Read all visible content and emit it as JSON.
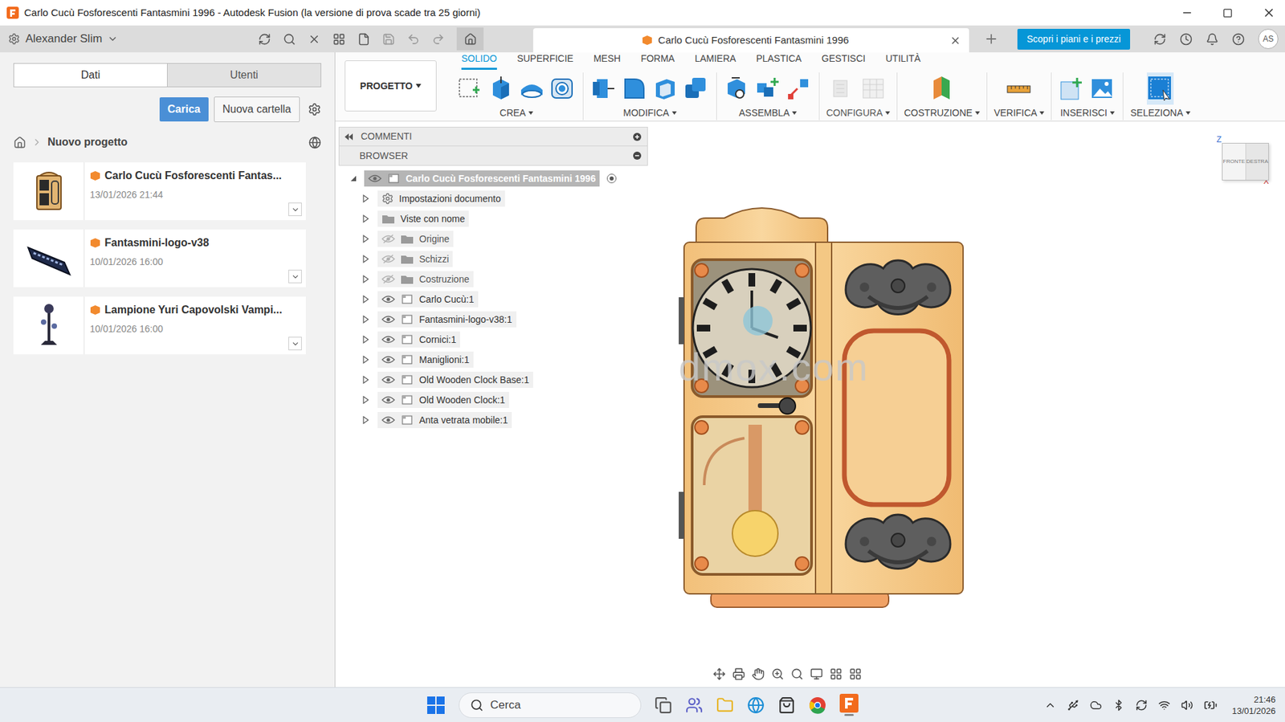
{
  "window": {
    "title": "Carlo Cucù Fosforescenti Fantasmini 1996 - Autodesk Fusion (la versione di prova scade tra 25 giorni)"
  },
  "app_bar": {
    "user": "Alexander Slim",
    "document_tab": {
      "label": "Carlo Cucù Fosforescenti Fantasmini 1996",
      "selected": true
    },
    "plans_button": "Scopri i piani e i prezzi",
    "avatar": "AS"
  },
  "data_panel": {
    "tabs": [
      {
        "label": "Dati",
        "selected": true
      },
      {
        "label": "Utenti",
        "selected": false
      }
    ],
    "upload_button": "Carica",
    "new_folder_button": "Nuova cartella",
    "breadcrumb": "Nuovo progetto",
    "files": [
      {
        "name": "Carlo Cucù Fosforescenti Fantas...",
        "date": "13/01/2026 21:44",
        "kind": "clock"
      },
      {
        "name": "Fantasmini-logo-v38",
        "date": "10/01/2026 16:00",
        "kind": "logo"
      },
      {
        "name": "Lampione Yuri Capovolski Vampi...",
        "date": "10/01/2026 16:00",
        "kind": "lamp"
      }
    ]
  },
  "ribbon": {
    "workspace": "PROGETTO",
    "tabs": [
      {
        "label": "SOLIDO",
        "selected": true
      },
      {
        "label": "SUPERFICIE",
        "selected": false
      },
      {
        "label": "MESH",
        "selected": false
      },
      {
        "label": "FORMA",
        "selected": false
      },
      {
        "label": "LAMIERA",
        "selected": false
      },
      {
        "label": "PLASTICA",
        "selected": false
      },
      {
        "label": "GESTISCI",
        "selected": false
      },
      {
        "label": "UTILITÀ",
        "selected": false
      }
    ],
    "groups": [
      {
        "label": "CREA",
        "tools": [
          "sketch",
          "extrude",
          "revolve",
          "hole"
        ],
        "disabled": false,
        "selected": false
      },
      {
        "label": "MODIFICA",
        "tools": [
          "presspull",
          "fillet",
          "shell",
          "combine"
        ],
        "disabled": false,
        "selected": false
      },
      {
        "label": "ASSEMBLA",
        "tools": [
          "newcomponent",
          "rigid",
          "joint"
        ],
        "disabled": false,
        "selected": false
      },
      {
        "label": "CONFIGURA",
        "tools": [
          "config",
          "table"
        ],
        "disabled": true,
        "selected": false
      },
      {
        "label": "COSTRUZIONE",
        "tools": [
          "plane"
        ],
        "disabled": false,
        "selected": false
      },
      {
        "label": "VERIFICA",
        "tools": [
          "measure"
        ],
        "disabled": false,
        "selected": false
      },
      {
        "label": "INSERISCI",
        "tools": [
          "insert",
          "image"
        ],
        "disabled": false,
        "selected": false
      },
      {
        "label": "SELEZIONA",
        "tools": [
          "select"
        ],
        "disabled": false,
        "selected": true
      }
    ]
  },
  "browser": {
    "comments": "COMMENTI",
    "title": "BROWSER",
    "root": {
      "label": "Carlo Cucù Fosforescenti Fantasmini 1996",
      "selected": true,
      "visible": true
    },
    "items": [
      {
        "label": "Impostazioni documento",
        "kind": "settings",
        "visible": true
      },
      {
        "label": "Viste con nome",
        "kind": "views",
        "visible": true
      },
      {
        "label": "Origine",
        "kind": "folder",
        "visible": false
      },
      {
        "label": "Schizzi",
        "kind": "folder",
        "visible": false
      },
      {
        "label": "Costruzione",
        "kind": "folder",
        "visible": false
      },
      {
        "label": "Carlo Cucù:1",
        "kind": "component",
        "visible": true
      },
      {
        "label": "Fantasmini-logo-v38:1",
        "kind": "component",
        "visible": true
      },
      {
        "label": "Cornici:1",
        "kind": "component",
        "visible": true
      },
      {
        "label": "Maniglioni:1",
        "kind": "component",
        "visible": true
      },
      {
        "label": "Old Wooden Clock Base:1",
        "kind": "component",
        "visible": true
      },
      {
        "label": "Old Wooden Clock:1",
        "kind": "component",
        "visible": true
      },
      {
        "label": "Anta vetrata mobile:1",
        "kind": "component",
        "visible": true
      }
    ]
  },
  "watermark": "dmox.com",
  "viewcube": {
    "faces": [
      "FRONTE",
      "DESTRA"
    ],
    "axes": [
      "Z",
      "X"
    ]
  },
  "taskbar": {
    "search": "Cerca",
    "time": "21:46",
    "date": "13/01/2026"
  }
}
